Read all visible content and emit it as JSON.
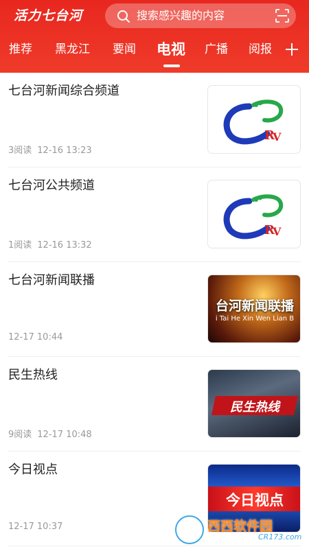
{
  "header": {
    "logo_text": "活力七台河",
    "search_placeholder": "搜索感兴趣的内容",
    "brand_color": "#e8271f"
  },
  "tabs": [
    {
      "label": "推荐",
      "active": false
    },
    {
      "label": "黑龙江",
      "active": false
    },
    {
      "label": "要闻",
      "active": false
    },
    {
      "label": "电视",
      "active": true
    },
    {
      "label": "广播",
      "active": false
    },
    {
      "label": "阅报",
      "active": false
    }
  ],
  "icons": {
    "search": "search-icon",
    "scan": "scan-icon",
    "add_tab": "plus-icon"
  },
  "items": [
    {
      "title": "七台河新闻综合频道",
      "reads": "3阅读",
      "time": "12-16 13:23",
      "thumb": "channel-logo"
    },
    {
      "title": "七台河公共频道",
      "reads": "1阅读",
      "time": "12-16 13:32",
      "thumb": "channel-logo"
    },
    {
      "title": "七台河新闻联播",
      "reads": "",
      "time": "12-17 10:44",
      "thumb": "news-broadcast",
      "thumb_caption": "台河新闻联播",
      "thumb_subcaption": "i Tai He Xin Wen Lian B"
    },
    {
      "title": "民生热线",
      "reads": "9阅读",
      "time": "12-17 10:48",
      "thumb": "minsheng",
      "thumb_caption": "民生热线"
    },
    {
      "title": "今日视点",
      "reads": "",
      "time": "12-17 10:37",
      "thumb": "today",
      "thumb_caption": "今日视点"
    }
  ],
  "watermark": {
    "text": "西西软件园",
    "sub": "CR173.com"
  }
}
